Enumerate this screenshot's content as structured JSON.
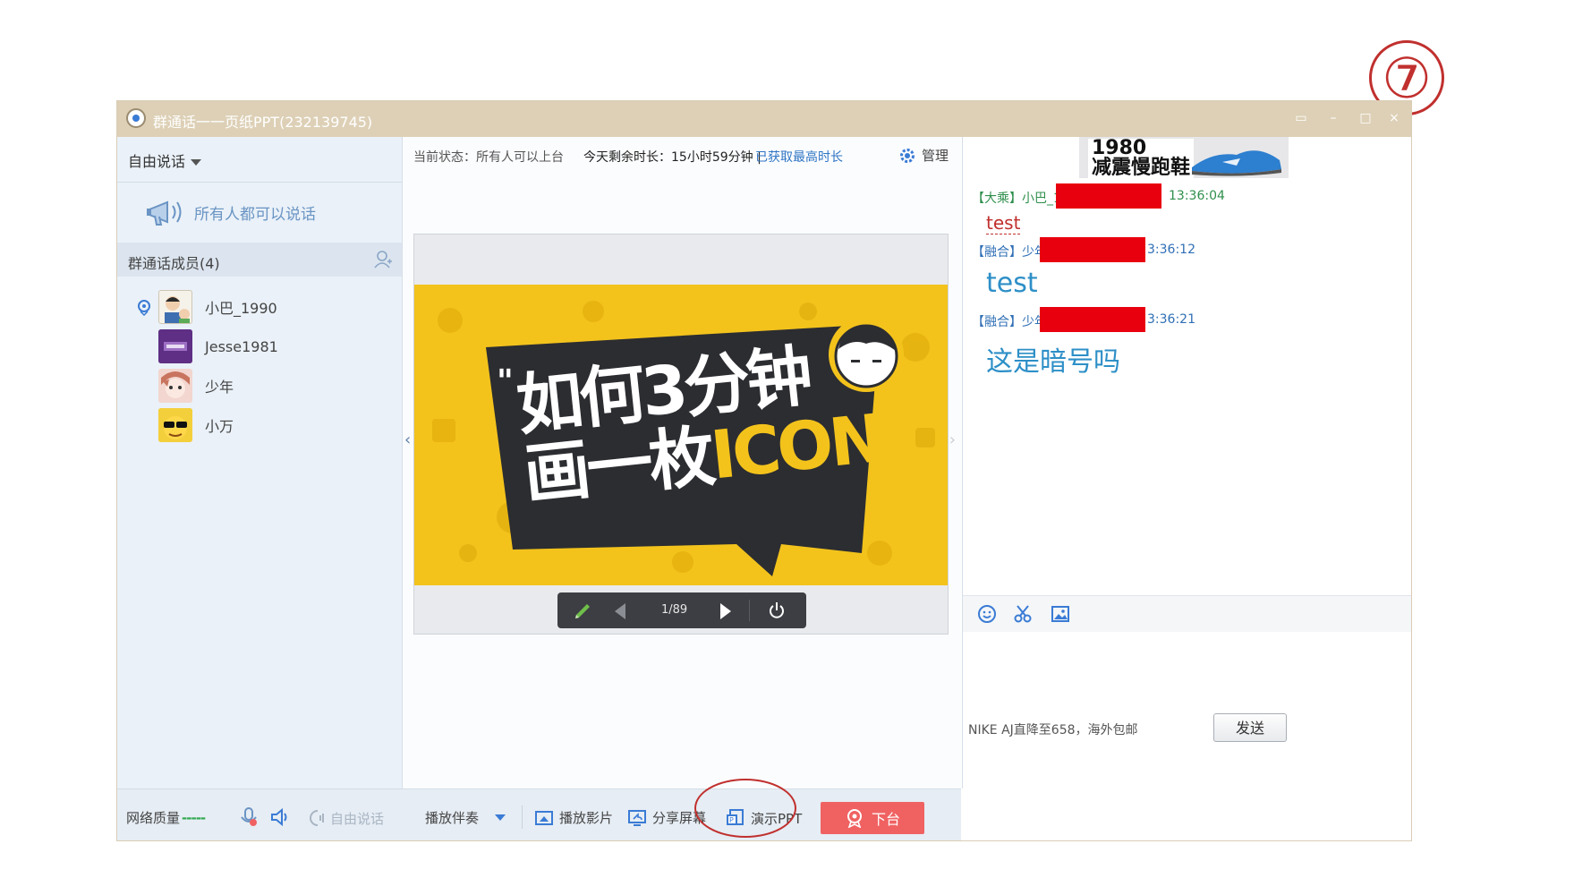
{
  "step_marker": "⑦",
  "window": {
    "title": "群通话一一页纸PPT(232139745)"
  },
  "left": {
    "mode": "自由说话",
    "speak_all": "所有人都可以说话",
    "members_header": "群通话成员(4)",
    "members": [
      {
        "name": "小巴_1990",
        "speaking": true
      },
      {
        "name": "Jesse1981",
        "speaking": false
      },
      {
        "name": "少年",
        "speaking": false
      },
      {
        "name": "小万",
        "speaking": false
      }
    ]
  },
  "center": {
    "status_current": "当前状态：所有人可以上台",
    "status_remaining": "今天剩余时长：15小时59分钟 |",
    "status_link": "已获取最高时长",
    "manage": "管理",
    "slide": {
      "line1": "如何3分钟",
      "line2a": "画一枚",
      "line2b": "ICON"
    },
    "page_counter": "1/89"
  },
  "right": {
    "ad_banner": "1980\n减震慢跑鞋",
    "messages": [
      {
        "tag": "【大乘】",
        "name": "小巴_1",
        "time": "13:36:04",
        "body": "test"
      },
      {
        "tag": "【融合】",
        "name": "少年",
        "time": "3:36:12",
        "body": "test"
      },
      {
        "tag": "【融合】",
        "name": "少年",
        "time": "3:36:21",
        "body": "这是暗号吗"
      }
    ],
    "ad_link": "NIKE AJ直降至658，海外包邮",
    "send": "发送"
  },
  "bottom": {
    "network": "网络质量",
    "network_signal": "-----",
    "free_talk": "自由说话",
    "accompany": "播放伴奏",
    "play_video": "播放影片",
    "share_screen": "分享屏幕",
    "present_ppt": "演示PPT",
    "leave_stage": "下台"
  },
  "colors": {
    "titlebar": "#ddd0b6",
    "slide_yellow": "#f3c31c",
    "leave_button": "#f06262",
    "highlight_ring": "#c0302e",
    "chat_blue": "#2d8fc7"
  }
}
